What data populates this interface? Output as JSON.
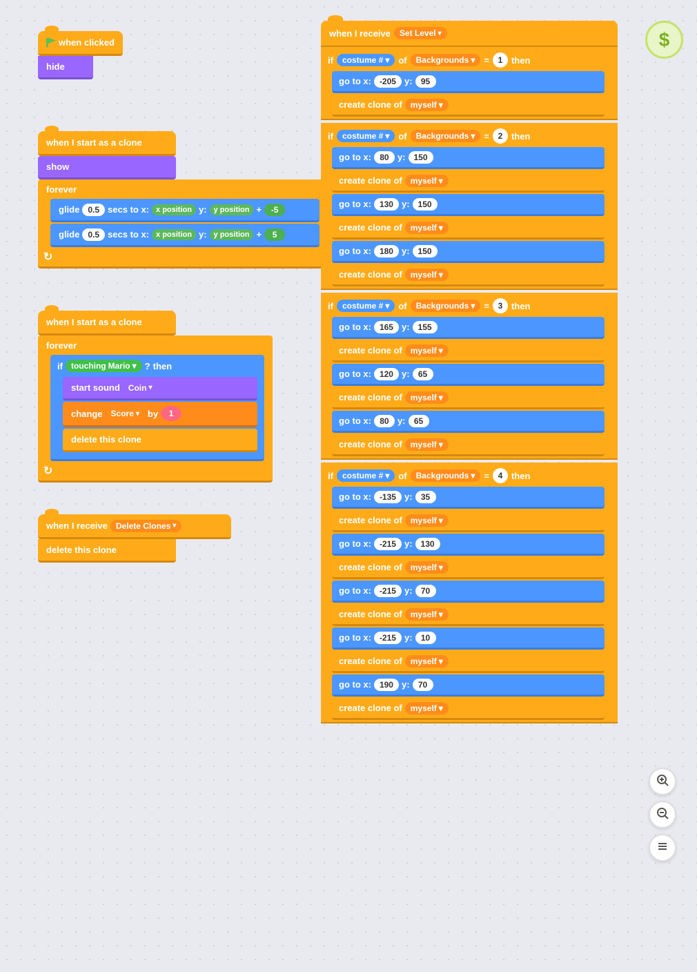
{
  "groups": {
    "group1": {
      "hat": "when  clicked",
      "blocks": [
        "hide"
      ]
    },
    "group2": {
      "hat": "when I start as a clone",
      "show": "show",
      "forever": "forever",
      "glide1": {
        "label": "glide",
        "secs": "0.5",
        "text1": "secs to x:",
        "xpos": "x position",
        "text2": "y:",
        "ypos": "y position",
        "op": "+",
        "val": "-5"
      },
      "glide2": {
        "label": "glide",
        "secs": "0.5",
        "text1": "secs to x:",
        "xpos": "x position",
        "text2": "y:",
        "ypos": "y position",
        "op": "+",
        "val": "5"
      }
    },
    "group3": {
      "hat": "when I start as a clone",
      "forever": "forever",
      "if_touching": "if",
      "touching_label": "touching",
      "touching_sprite": "Mario",
      "question_mark": "?",
      "then": "then",
      "start_sound": "start sound",
      "sound_name": "Coin",
      "change": "change",
      "variable": "Score",
      "by": "by",
      "amount": "1",
      "delete_clone": "delete this clone"
    },
    "group4": {
      "hat": "when I receive",
      "message": "Delete Clones",
      "delete_clone": "delete this clone"
    }
  },
  "right_panel": {
    "hat_receive": "when I receive",
    "message": "Set Level",
    "if_label": "if",
    "costume_label": "costume #",
    "of_label": "of",
    "backgrounds_label": "Backgrounds",
    "then_label": "then",
    "sections": [
      {
        "condition_num": "1",
        "blocks": [
          {
            "type": "goto",
            "x": "-205",
            "y": "95"
          },
          {
            "type": "clone",
            "of": "myself"
          }
        ]
      },
      {
        "condition_num": "2",
        "blocks": [
          {
            "type": "goto",
            "x": "80",
            "y": "150"
          },
          {
            "type": "clone",
            "of": "myself"
          },
          {
            "type": "goto",
            "x": "130",
            "y": "150"
          },
          {
            "type": "clone",
            "of": "myself"
          },
          {
            "type": "goto",
            "x": "180",
            "y": "150"
          },
          {
            "type": "clone",
            "of": "myself"
          }
        ]
      },
      {
        "condition_num": "3",
        "blocks": [
          {
            "type": "goto",
            "x": "165",
            "y": "155"
          },
          {
            "type": "clone",
            "of": "myself"
          },
          {
            "type": "goto",
            "x": "120",
            "y": "65"
          },
          {
            "type": "clone",
            "of": "myself"
          },
          {
            "type": "goto",
            "x": "80",
            "y": "65"
          },
          {
            "type": "clone",
            "of": "myself"
          }
        ]
      },
      {
        "condition_num": "4",
        "blocks": [
          {
            "type": "goto",
            "x": "-135",
            "y": "35"
          },
          {
            "type": "clone",
            "of": "myself"
          },
          {
            "type": "goto",
            "x": "-215",
            "y": "130"
          },
          {
            "type": "clone",
            "of": "myself"
          },
          {
            "type": "goto",
            "x": "-215",
            "y": "70"
          },
          {
            "type": "clone",
            "of": "myself"
          },
          {
            "type": "goto",
            "x": "-215",
            "y": "10"
          },
          {
            "type": "clone",
            "of": "myself"
          },
          {
            "type": "goto",
            "x": "190",
            "y": "70"
          },
          {
            "type": "clone",
            "of": "myself"
          }
        ]
      }
    ]
  },
  "zoom": {
    "plus": "+",
    "minus": "−",
    "fit": "="
  },
  "dollar_badge": "$"
}
